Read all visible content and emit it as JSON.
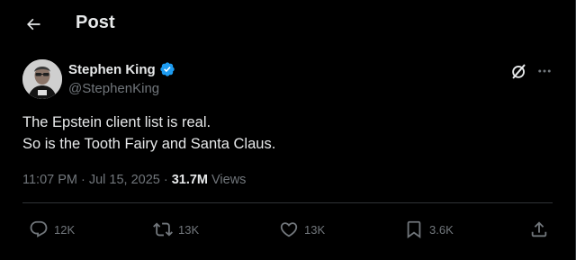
{
  "header": {
    "back_icon": "arrow-left-icon",
    "title": "Post"
  },
  "post": {
    "author": {
      "name": "Stephen King",
      "handle": "@StephenKing",
      "verified": true,
      "verified_color": "#1d9bf0"
    },
    "text_lines": [
      "The Epstein client list is real.",
      "So is the Tooth Fairy and Santa Claus."
    ],
    "meta": {
      "time": "11:07 PM",
      "separator": "·",
      "date": "Jul 15, 2025",
      "views_count": "31.7M",
      "views_label": "Views"
    },
    "actions": {
      "replies": "12K",
      "reposts": "13K",
      "likes": "13K",
      "bookmarks": "3.6K"
    }
  },
  "colors": {
    "background": "#000000",
    "text_primary": "#e7e9ea",
    "text_secondary": "#71767b",
    "divider": "#2f3336"
  }
}
